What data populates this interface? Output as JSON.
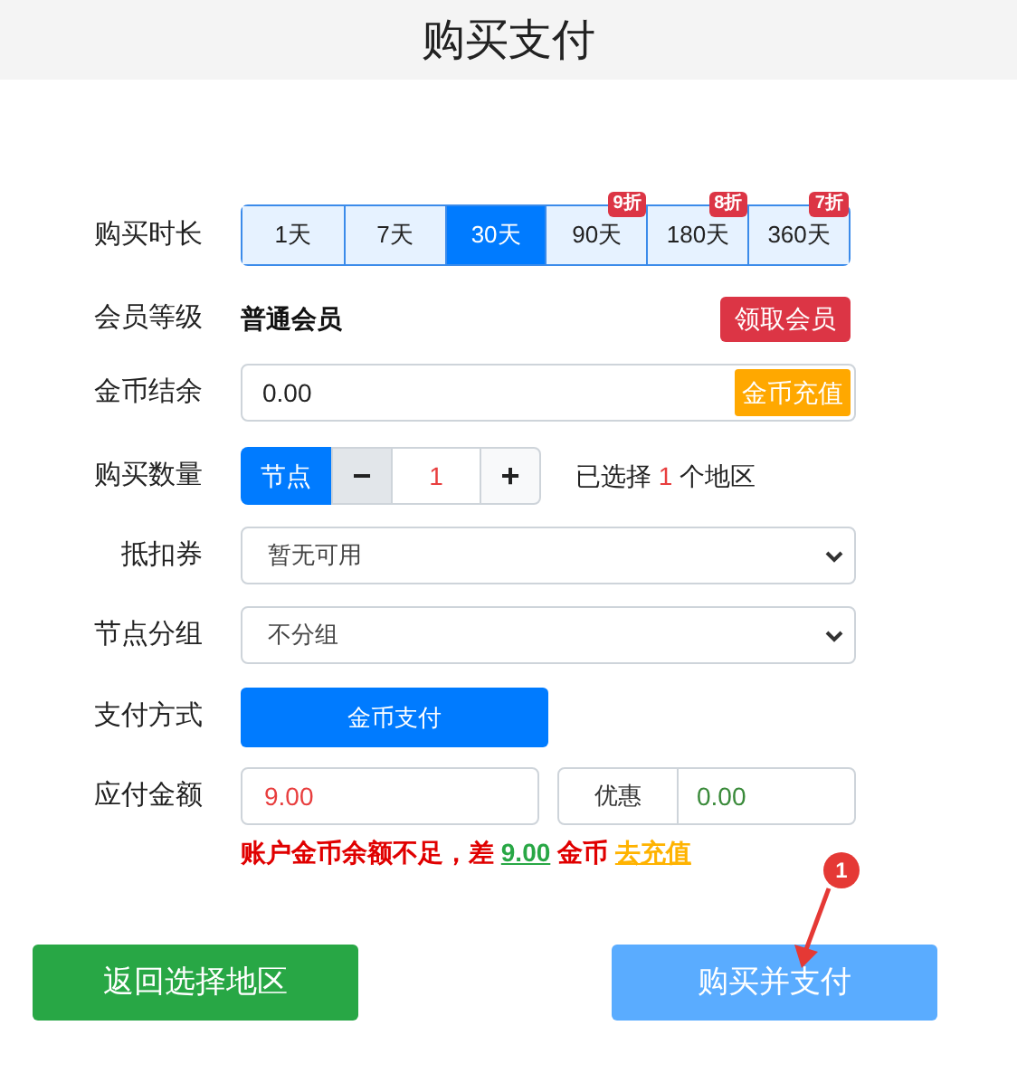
{
  "header": {
    "title": "购买支付"
  },
  "duration": {
    "label": "购买时长",
    "options": [
      {
        "label": "1天",
        "selected": false
      },
      {
        "label": "7天",
        "selected": false
      },
      {
        "label": "30天",
        "selected": true
      },
      {
        "label": "90天",
        "selected": false,
        "badge": "9折"
      },
      {
        "label": "180天",
        "selected": false,
        "badge": "8折"
      },
      {
        "label": "360天",
        "selected": false,
        "badge": "7折"
      }
    ]
  },
  "member": {
    "label": "会员等级",
    "value": "普通会员",
    "button": "领取会员"
  },
  "coins": {
    "label": "金币结余",
    "value": "0.00",
    "button": "金币充值"
  },
  "quantity": {
    "label": "购买数量",
    "unit": "节点",
    "minus": "−",
    "value": "1",
    "plus": "+",
    "note_before": "已选择",
    "note_count": "1",
    "note_after": "个地区"
  },
  "coupon": {
    "label": "抵扣券",
    "value": "暂无可用"
  },
  "group": {
    "label": "节点分组",
    "value": "不分组"
  },
  "payment": {
    "label": "支付方式",
    "button": "金币支付"
  },
  "amount": {
    "label": "应付金额",
    "value": "9.00",
    "discount_label": "优惠",
    "discount_value": "0.00"
  },
  "warning": {
    "text_before": "账户金币余额不足，差",
    "amount": "9.00",
    "unit": "金币",
    "link": "去充值"
  },
  "buttons": {
    "back": "返回选择地区",
    "buy": "购买并支付"
  },
  "annotation": {
    "number": "1"
  }
}
